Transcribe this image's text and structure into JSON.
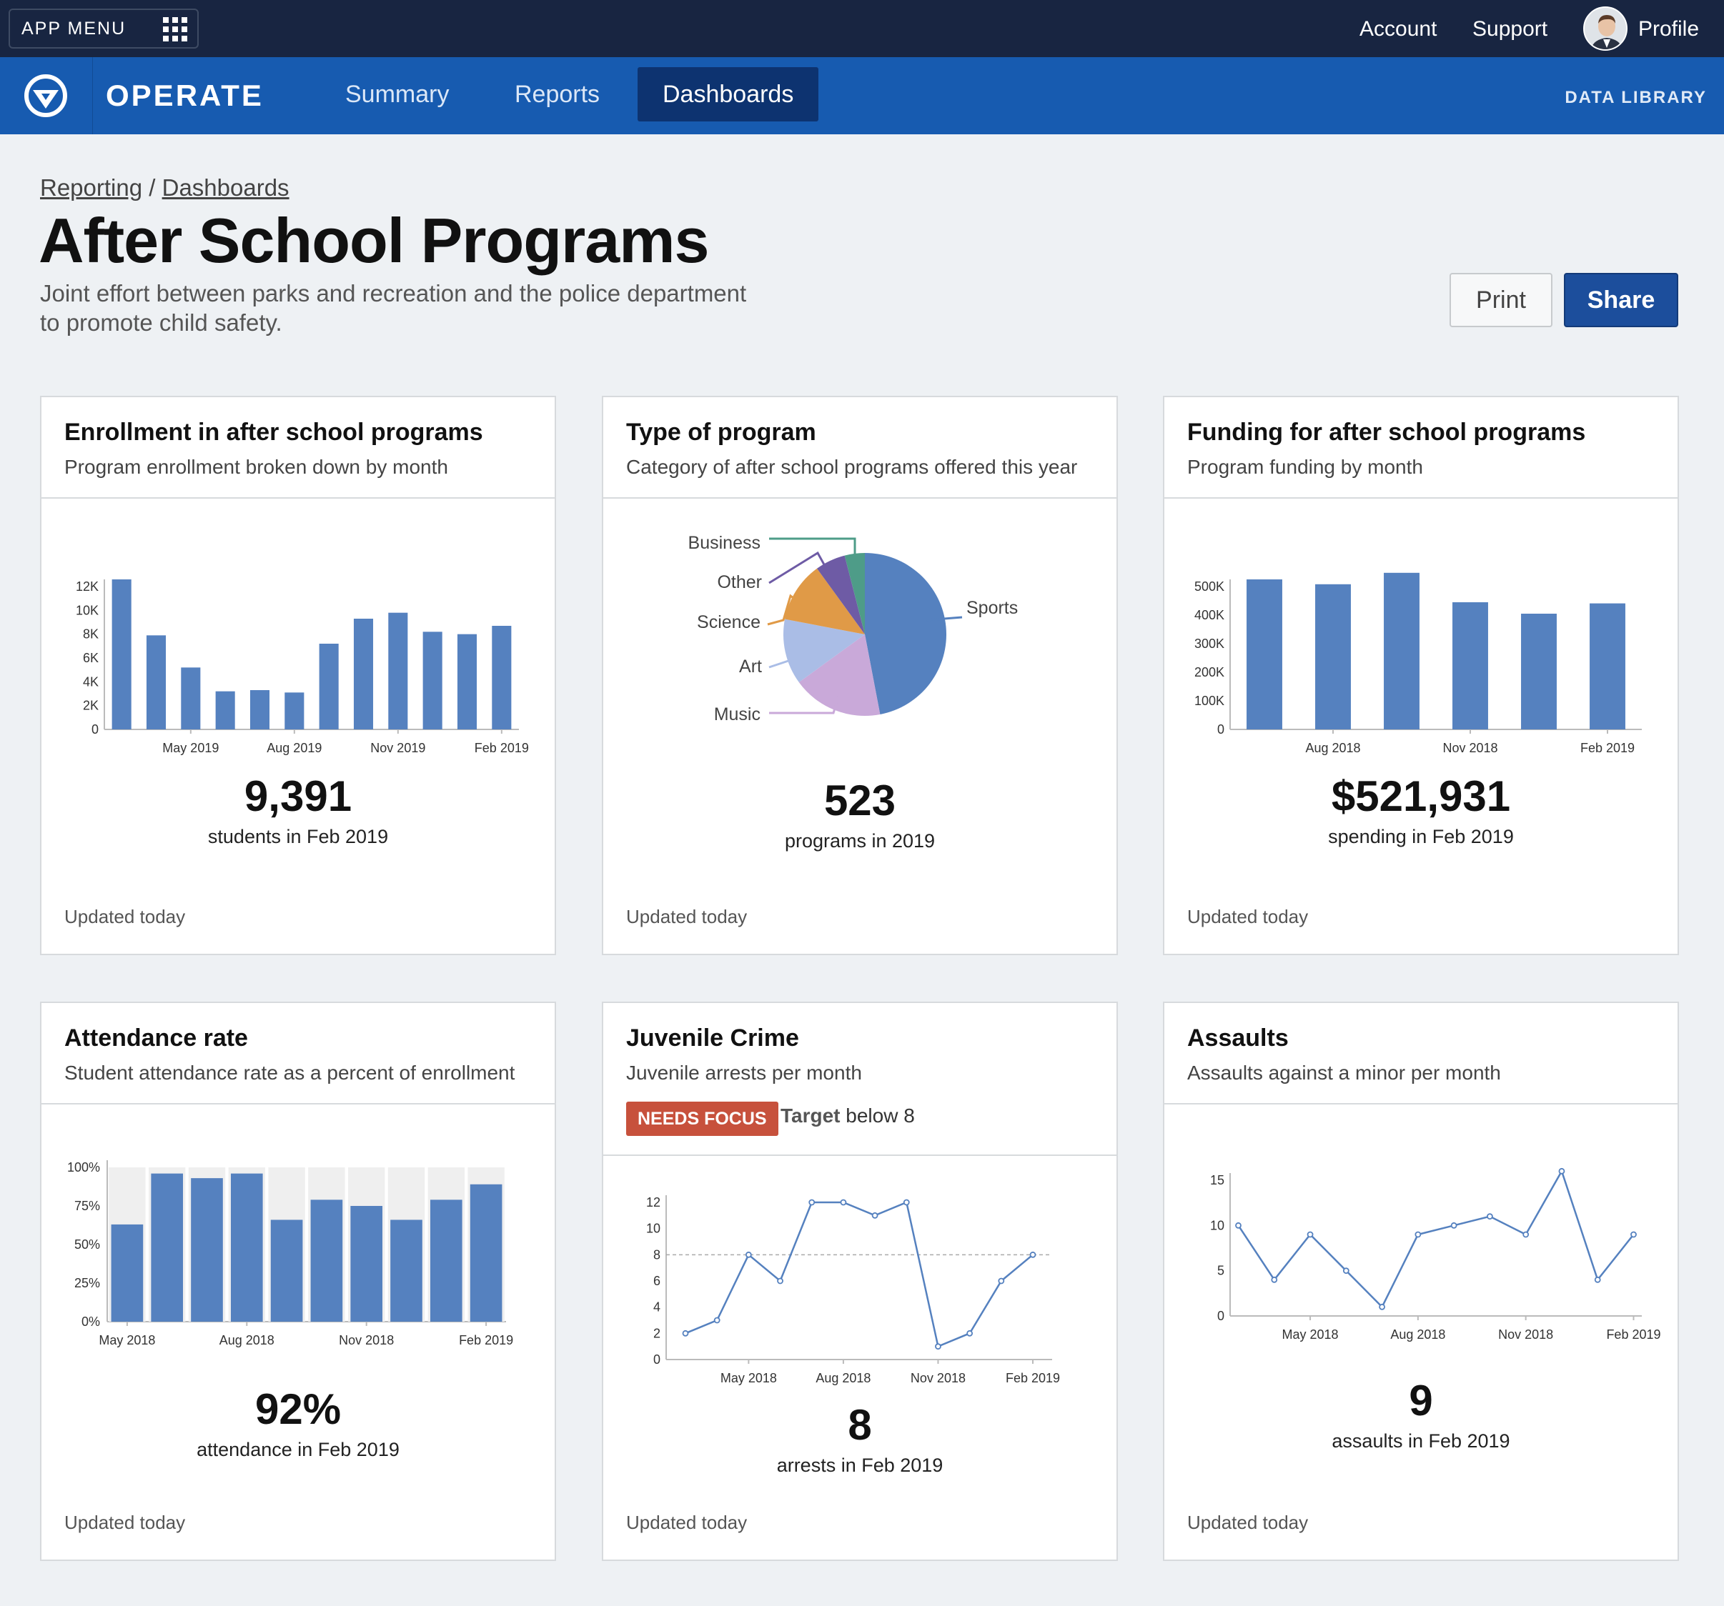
{
  "topbar": {
    "app_menu": "APP MENU",
    "account": "Account",
    "support": "Support",
    "profile": "Profile"
  },
  "nav": {
    "brand": "OPERATE",
    "tabs": [
      "Summary",
      "Reports",
      "Dashboards"
    ],
    "active_tab": "Dashboards",
    "data_library": "DATA LIBRARY"
  },
  "breadcrumb": {
    "reporting": "Reporting",
    "sep": "/",
    "dashboards": "Dashboards"
  },
  "page": {
    "title": "After School Programs",
    "subtitle_line1": "Joint effort between parks and recreation and the police department",
    "subtitle_line2": "to promote child safety.",
    "print": "Print",
    "share": "Share"
  },
  "colors": {
    "bar": "#5581bf",
    "track": "#efefef",
    "pie_sports": "#5581bf",
    "pie_music": "#c9a9d9",
    "pie_art": "#aabde6",
    "pie_science": "#e09a47",
    "pie_other": "#6e5ba5",
    "pie_business": "#4e9c88",
    "badge": "#c7513c"
  },
  "cards": [
    {
      "title": "Enrollment in after school programs",
      "desc": "Program enrollment broken down by month",
      "value": "9,391",
      "caption": "students in Feb 2019",
      "updated": "Updated today"
    },
    {
      "title": "Type of program",
      "desc": "Category of after school programs offered this year",
      "value": "523",
      "caption": "programs in 2019",
      "updated": "Updated today"
    },
    {
      "title": "Funding for after school programs",
      "desc": "Program funding by month",
      "value": "$521,931",
      "caption": "spending in Feb 2019",
      "updated": "Updated today"
    },
    {
      "title": "Attendance rate",
      "desc": "Student attendance rate as a percent of enrollment",
      "value": "92%",
      "caption": "attendance in Feb 2019",
      "updated": "Updated today"
    },
    {
      "title": "Juvenile Crime",
      "desc": "Juvenile arrests per month",
      "badge": "NEEDS FOCUS",
      "target_label": "Target",
      "target_value": "below 8",
      "value": "8",
      "caption": "arrests in Feb 2019",
      "updated": "Updated today"
    },
    {
      "title": "Assaults",
      "desc": "Assaults against a minor per month",
      "value": "9",
      "caption": "assaults in Feb 2019",
      "updated": "Updated today"
    }
  ],
  "chart_data": [
    {
      "type": "bar",
      "title": "Enrollment in after school programs",
      "ytick_labels": [
        "0",
        "2K",
        "4K",
        "6K",
        "8K",
        "10K",
        "12K"
      ],
      "ylim": [
        0,
        12000
      ],
      "xtick_labels": [
        "May 2019",
        "Aug 2019",
        "Nov 2019",
        "Feb 2019"
      ],
      "xtick_index": [
        2,
        5,
        8,
        11
      ],
      "values": [
        12600,
        7900,
        5200,
        3200,
        3300,
        3100,
        7200,
        9300,
        9800,
        8200,
        8000,
        8700
      ]
    },
    {
      "type": "pie",
      "title": "Type of program",
      "slices": [
        {
          "label": "Sports",
          "value": 47,
          "color": "#5581bf"
        },
        {
          "label": "Music",
          "value": 18,
          "color": "#c9a9d9"
        },
        {
          "label": "Art",
          "value": 13,
          "color": "#aabde6"
        },
        {
          "label": "Science",
          "value": 12,
          "color": "#e09a47"
        },
        {
          "label": "Other",
          "value": 6,
          "color": "#6e5ba5"
        },
        {
          "label": "Business",
          "value": 4,
          "color": "#4e9c88"
        }
      ]
    },
    {
      "type": "bar",
      "title": "Funding for after school programs",
      "ytick_labels": [
        "0",
        "100K",
        "200K",
        "300K",
        "400K",
        "500K"
      ],
      "ylim": [
        0,
        500000
      ],
      "xtick_labels": [
        "Aug 2018",
        "Nov 2018",
        "Feb 2019"
      ],
      "xtick_index": [
        1,
        3,
        5
      ],
      "values": [
        525000,
        508000,
        548000,
        445000,
        405000,
        441000
      ]
    },
    {
      "type": "bar",
      "title": "Attendance rate",
      "ytick_labels": [
        "0%",
        "25%",
        "50%",
        "75%",
        "100%"
      ],
      "ylim": [
        0,
        100
      ],
      "xtick_labels": [
        "May 2018",
        "Aug 2018",
        "Nov 2018",
        "Feb 2019"
      ],
      "xtick_index": [
        0,
        3,
        6,
        9
      ],
      "values": [
        63,
        96,
        93,
        96,
        66,
        79,
        75,
        66,
        79,
        89
      ]
    },
    {
      "type": "line",
      "title": "Juvenile Crime",
      "ytick_labels": [
        "0",
        "2",
        "4",
        "6",
        "8",
        "10",
        "12"
      ],
      "ylim": [
        0,
        12
      ],
      "target": 8,
      "xtick_labels": [
        "May 2018",
        "Aug 2018",
        "Nov 2018",
        "Feb 2019"
      ],
      "xtick_index": [
        2,
        5,
        8,
        11
      ],
      "values": [
        2,
        3,
        8,
        6,
        12,
        12,
        11,
        12,
        1,
        2,
        6,
        8
      ]
    },
    {
      "type": "line",
      "title": "Assaults",
      "ytick_labels": [
        "0",
        "5",
        "10",
        "15"
      ],
      "ylim": [
        0,
        15
      ],
      "xtick_labels": [
        "May 2018",
        "Aug 2018",
        "Nov 2018",
        "Feb 2019"
      ],
      "xtick_index": [
        2,
        5,
        8,
        11
      ],
      "values": [
        10,
        4,
        9,
        5,
        1,
        9,
        10,
        11,
        9,
        16,
        4,
        9
      ]
    }
  ]
}
